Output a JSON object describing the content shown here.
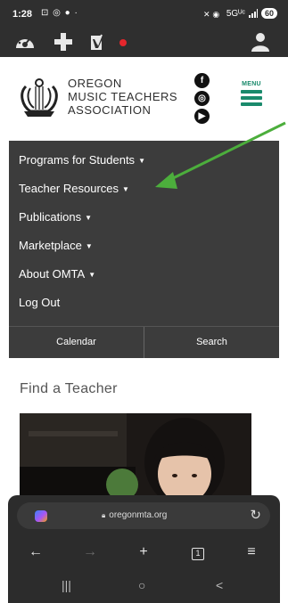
{
  "status_bar": {
    "time": "1:28",
    "notif_icons": "⊡ ◎ ● ·",
    "network_text": "5Gᵁᶜ",
    "battery": "60"
  },
  "admin_bar": {
    "icons": [
      "dashboard-icon",
      "add-new-icon",
      "yoast-seo-icon",
      "status-dot-icon",
      "account-icon"
    ],
    "status_dot_color": "#e5262c"
  },
  "header": {
    "org_line1": "OREGON",
    "org_line2": "MUSIC TEACHERS",
    "org_line3": "ASSOCIATION",
    "social": [
      "facebook-icon",
      "instagram-icon",
      "youtube-icon"
    ],
    "menu_label": "MENU",
    "accent_color": "#1a8a6c"
  },
  "nav": {
    "items": [
      {
        "label": "Programs for Students",
        "caret": "▼"
      },
      {
        "label": "Teacher Resources",
        "caret": "▼"
      },
      {
        "label": "Publications",
        "caret": "▼"
      },
      {
        "label": "Marketplace",
        "caret": "▼"
      },
      {
        "label": "About OMTA",
        "caret": "▼"
      },
      {
        "label": "Log Out",
        "caret": ""
      }
    ],
    "calendar": "Calendar",
    "search": "Search",
    "background": "#3c3c3c"
  },
  "annotation": {
    "arrow_color": "#4cae3c",
    "points_to": "Teacher Resources"
  },
  "content": {
    "find_title": "Find a Teacher"
  },
  "browser": {
    "url": "oregonmta.org",
    "reload_icon": "↻",
    "back": "←",
    "forward": "→",
    "new_tab": "+",
    "tab_count": "1",
    "menu": "≡"
  },
  "system_nav": {
    "recents": "|||",
    "home": "○",
    "back": "<"
  }
}
